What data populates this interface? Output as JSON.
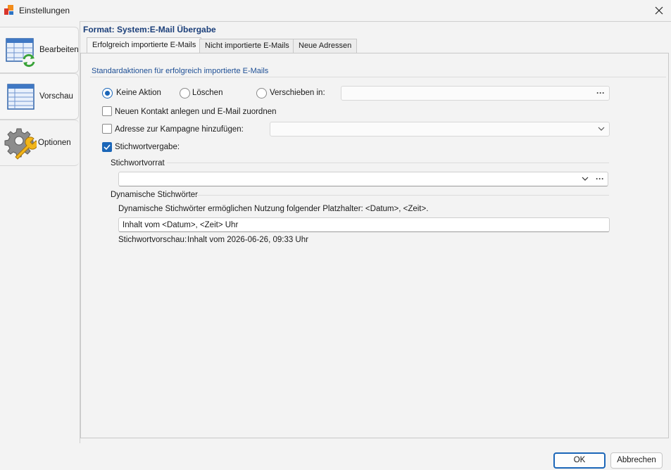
{
  "window": {
    "title": "Einstellungen"
  },
  "sidebar": {
    "items": [
      {
        "label": "Bearbeiten",
        "icon": "table-refresh-icon"
      },
      {
        "label": "Vorschau",
        "icon": "table-preview-icon"
      },
      {
        "label": "Optionen",
        "icon": "gear-wrench-icon"
      }
    ]
  },
  "header": {
    "format_title": "Format:  System:E-Mail Übergabe"
  },
  "tabs": [
    {
      "label": "Erfolgreich importierte E-Mails"
    },
    {
      "label": "Nicht importierte E-Mails"
    },
    {
      "label": "Neue Adressen"
    }
  ],
  "group": {
    "title": "Standardaktionen für erfolgreich importierte E-Mails"
  },
  "radios": [
    {
      "label": "Keine Aktion",
      "checked": true
    },
    {
      "label": "Löschen",
      "checked": false
    },
    {
      "label": "Verschieben in:",
      "checked": false
    }
  ],
  "move_target": {
    "value": "",
    "browse": "···"
  },
  "checkboxes": {
    "new_contact": {
      "label": "Neuen Kontakt anlegen und E-Mail zuordnen",
      "checked": false
    },
    "campaign": {
      "label": "Adresse zur Kampagne hinzufügen:",
      "checked": false
    },
    "keywords": {
      "label": "Stichwortvergabe:",
      "checked": true
    }
  },
  "campaign_select": {
    "value": ""
  },
  "keyword_pool": {
    "title": "Stichwortvorrat",
    "value": "",
    "browse": "···"
  },
  "dynamic": {
    "title": "Dynamische Stichwörter",
    "description": "Dynamische Stichwörter ermöglichen Nutzung folgender Platzhalter: <Datum>, <Zeit>.",
    "input_value": "Inhalt vom <Datum>, <Zeit> Uhr",
    "preview_label": "Stichwortvorschau:",
    "preview_value": "Inhalt vom 2026-06-26, 09:33 Uhr"
  },
  "footer": {
    "ok": "OK",
    "cancel": "Abbrechen"
  },
  "colors": {
    "accent": "#1b66b8",
    "title_blue": "#1b3f7a",
    "group_blue": "#1e4f95"
  }
}
